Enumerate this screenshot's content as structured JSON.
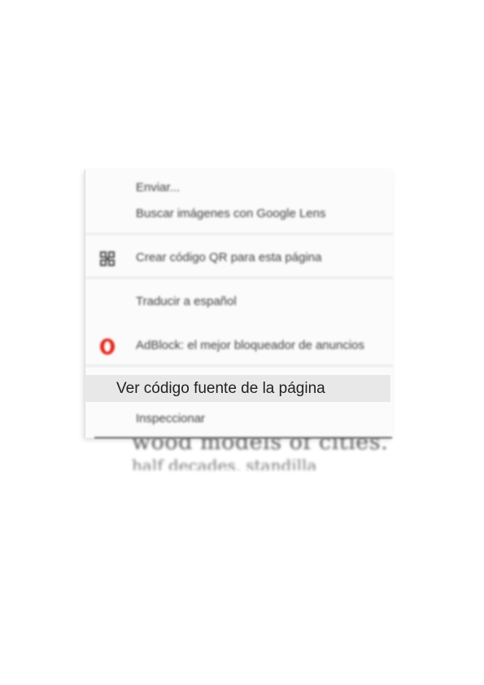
{
  "background_page": {
    "line1": "wood models of cities.",
    "line2": "half decades, standilla"
  },
  "context_menu": {
    "items": [
      {
        "label": "Enviar..."
      },
      {
        "label": "Buscar imágenes con Google Lens"
      },
      {
        "label": "Crear código QR para esta página",
        "icon": "qr-code-icon"
      },
      {
        "label": "Traducir a español"
      },
      {
        "label": "AdBlock: el mejor bloqueador de anuncios",
        "icon": "opera-adblock-icon"
      },
      {
        "label": "Ver código fuente de la página",
        "highlighted": true
      },
      {
        "label": "Inspeccionar"
      }
    ]
  },
  "colors": {
    "highlight": "#e8e8e8",
    "adblock_icon": "#e2261c"
  }
}
